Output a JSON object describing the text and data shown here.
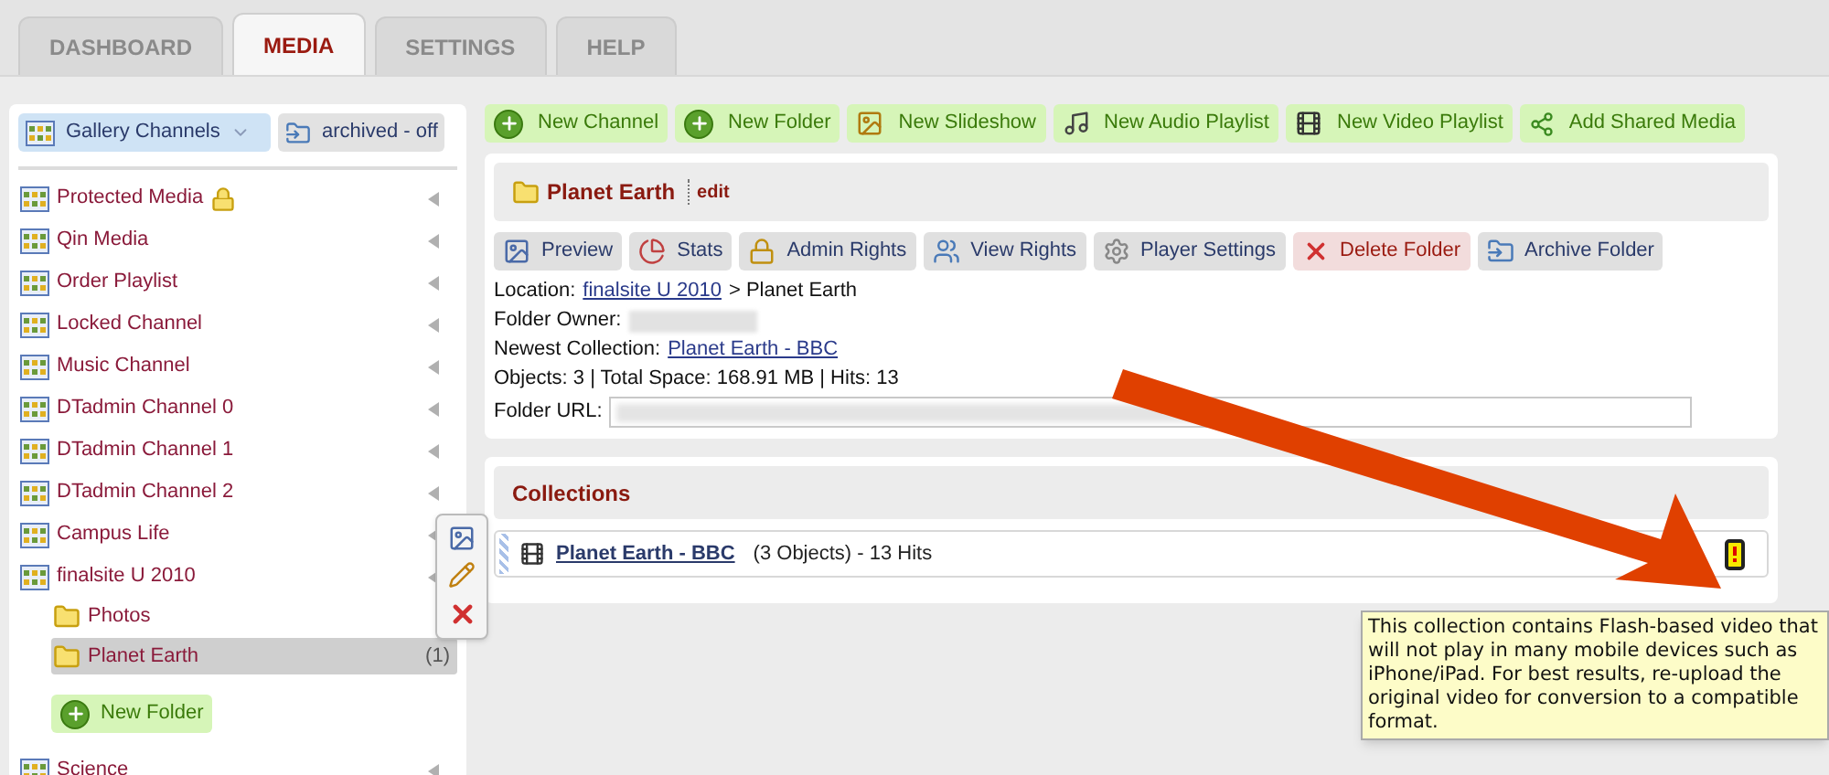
{
  "tabs": [
    {
      "label": "DASHBOARD",
      "selected": false
    },
    {
      "label": "MEDIA",
      "selected": true
    },
    {
      "label": "SETTINGS",
      "selected": false
    },
    {
      "label": "HELP",
      "selected": false
    }
  ],
  "sidebar": {
    "channel_menu": "Gallery Channels",
    "archived_toggle": "archived - off",
    "items": [
      {
        "label": "Protected Media",
        "locked": true
      },
      {
        "label": "Qin Media",
        "locked": false
      },
      {
        "label": "Order Playlist",
        "locked": false
      },
      {
        "label": "Locked Channel",
        "locked": false
      },
      {
        "label": "Music Channel",
        "locked": false
      },
      {
        "label": "DTadmin Channel 0",
        "locked": false
      },
      {
        "label": "DTadmin Channel 1",
        "locked": false
      },
      {
        "label": "DTadmin Channel 2",
        "locked": false
      },
      {
        "label": "Campus Life",
        "locked": false
      },
      {
        "label": "finalsite U 2010",
        "locked": false,
        "children": [
          {
            "label": "Photos",
            "selected": false
          },
          {
            "label": "Planet Earth",
            "selected": true,
            "count": "(1)"
          }
        ]
      },
      {
        "label": "Science",
        "locked": false
      }
    ],
    "new_folder": "New Folder"
  },
  "toolbar": [
    {
      "label": "New Channel"
    },
    {
      "label": "New Folder"
    },
    {
      "label": "New Slideshow"
    },
    {
      "label": "New Audio Playlist"
    },
    {
      "label": "New Video Playlist"
    },
    {
      "label": "Add Shared Media"
    }
  ],
  "folder": {
    "title": "Planet Earth",
    "edit": "edit",
    "actions": [
      {
        "label": "Preview",
        "kind": "normal"
      },
      {
        "label": "Stats",
        "kind": "normal"
      },
      {
        "label": "Admin Rights",
        "kind": "normal"
      },
      {
        "label": "View Rights",
        "kind": "normal"
      },
      {
        "label": "Player Settings",
        "kind": "normal"
      },
      {
        "label": "Delete Folder",
        "kind": "danger"
      },
      {
        "label": "Archive Folder",
        "kind": "normal"
      }
    ],
    "location_label": "Location:",
    "location_link": "finalsite U 2010",
    "location_rest": "> Planet Earth",
    "owner_label": "Folder Owner:",
    "newest_label": "Newest Collection:",
    "newest_link": "Planet Earth - BBC",
    "stats": "Objects: 3 | Total Space: 168.91 MB | Hits: 13",
    "url_label": "Folder URL:"
  },
  "collections": {
    "title": "Collections",
    "items": [
      {
        "name": "Planet Earth - BBC",
        "info": "(3 Objects) - 13 Hits",
        "warning": true
      }
    ]
  },
  "tooltip": "This collection contains Flash-based video that will not play in many mobile devices such as iPhone/iPad. For best results, re-upload the original video for conversion to a compatible format."
}
